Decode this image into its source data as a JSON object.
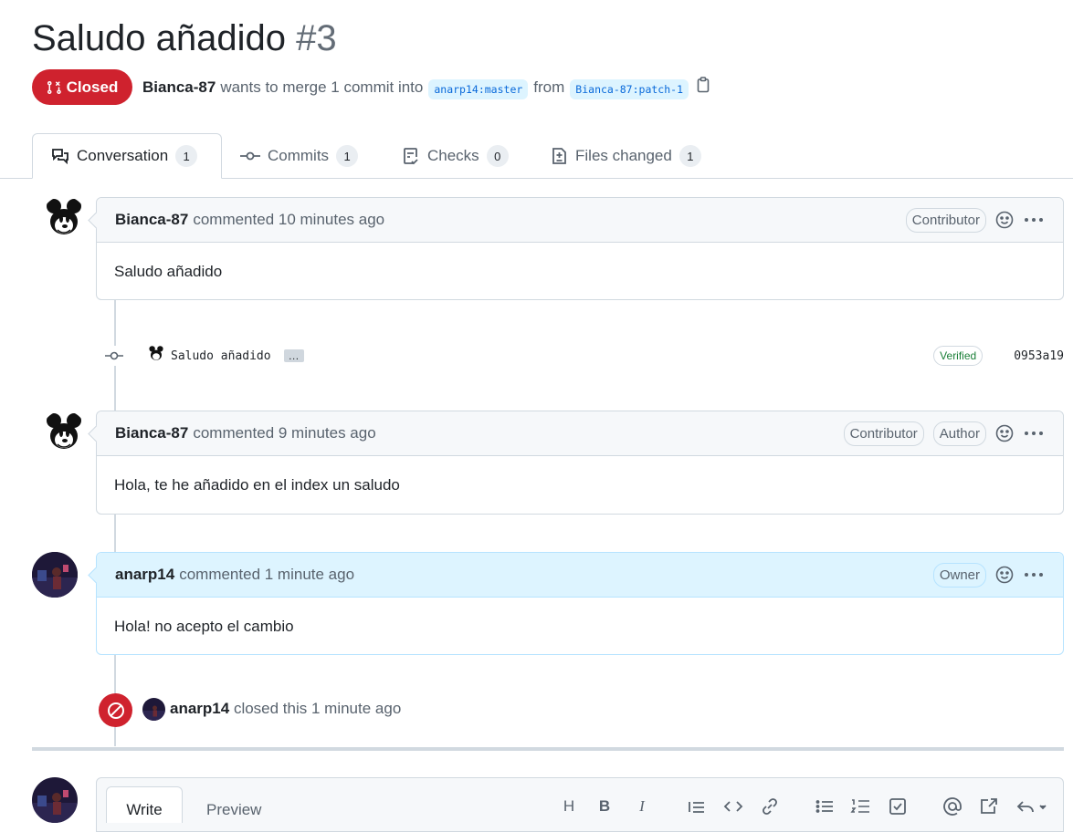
{
  "pr": {
    "title": "Saludo añadido",
    "number": "#3",
    "state": "Closed",
    "author": "Bianca-87",
    "merge_text": "wants to merge 1 commit into",
    "base_ref": "anarp14:master",
    "from_text": "from",
    "head_ref": "Bianca-87:patch-1"
  },
  "tabs": [
    {
      "label": "Conversation",
      "count": "1",
      "icon": "comment-discussion-icon"
    },
    {
      "label": "Commits",
      "count": "1",
      "icon": "git-commit-icon"
    },
    {
      "label": "Checks",
      "count": "0",
      "icon": "checklist-icon"
    },
    {
      "label": "Files changed",
      "count": "1",
      "icon": "file-diff-icon"
    }
  ],
  "comments": [
    {
      "author": "Bianca-87",
      "meta": "commented 10 minutes ago",
      "badges": [
        "Contributor"
      ],
      "body": "Saludo añadido"
    },
    {
      "author": "Bianca-87",
      "meta": "commented 9 minutes ago",
      "badges": [
        "Contributor",
        "Author"
      ],
      "body": "Hola, te he añadido en el index un saludo"
    },
    {
      "author": "anarp14",
      "meta": "commented 1 minute ago",
      "badges": [
        "Owner"
      ],
      "body": "Hola! no acepto el cambio"
    }
  ],
  "commit": {
    "message": "Saludo añadido",
    "ellipsis": "…",
    "verified": "Verified",
    "sha": "0953a19"
  },
  "closed_event": {
    "actor": "anarp14",
    "text": "closed this 1 minute ago"
  },
  "editor": {
    "write_tab": "Write",
    "preview_tab": "Preview",
    "tools": [
      "heading-icon",
      "bold-icon",
      "italic-icon",
      "quote-icon",
      "code-icon",
      "link-icon",
      "unordered-list-icon",
      "ordered-list-icon",
      "tasklist-icon",
      "mention-icon",
      "reference-icon",
      "reply-icon"
    ],
    "tool_glyphs": [
      "H",
      "B",
      "I"
    ]
  },
  "colors": {
    "closed": "#cf222e",
    "link_bg": "#ddf4ff",
    "link": "#0969da",
    "verified": "#1a7f37"
  }
}
